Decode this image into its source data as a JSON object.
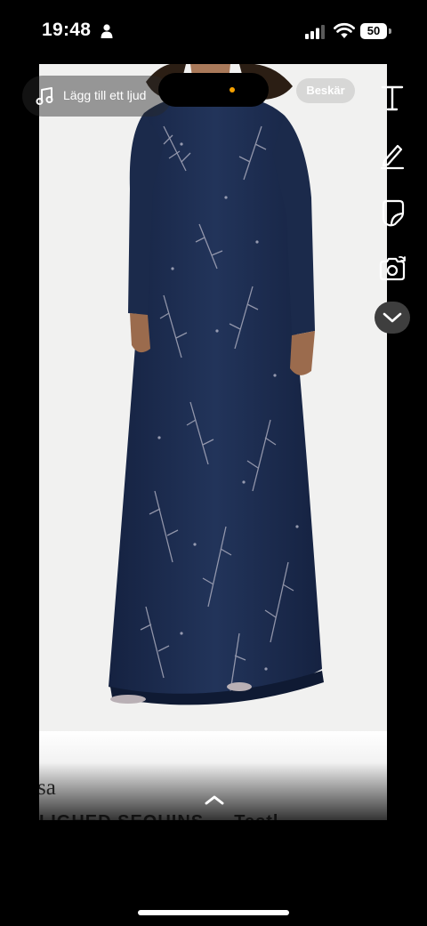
{
  "status_bar": {
    "time": "19:48",
    "battery": "50",
    "icons": [
      "person-icon",
      "signal-icon",
      "wifi-icon",
      "battery-icon"
    ]
  },
  "overlay": {
    "sound_label": "Lägg till ett ljud",
    "crop_label": "Beskär",
    "island_dot_color": "#f5a000"
  },
  "toolbar": {
    "items": [
      "text-tool-icon",
      "pen-tool-icon",
      "sticker-tool-icon",
      "camera-flip-icon",
      "chevron-down-icon"
    ]
  },
  "caption": {
    "brand_fragment": "sa",
    "title_fragment": "LIGHED SEQUINS — Testl.."
  },
  "photo": {
    "dress_color": "#1d2c4c",
    "background_color": "#f1f1f0"
  }
}
